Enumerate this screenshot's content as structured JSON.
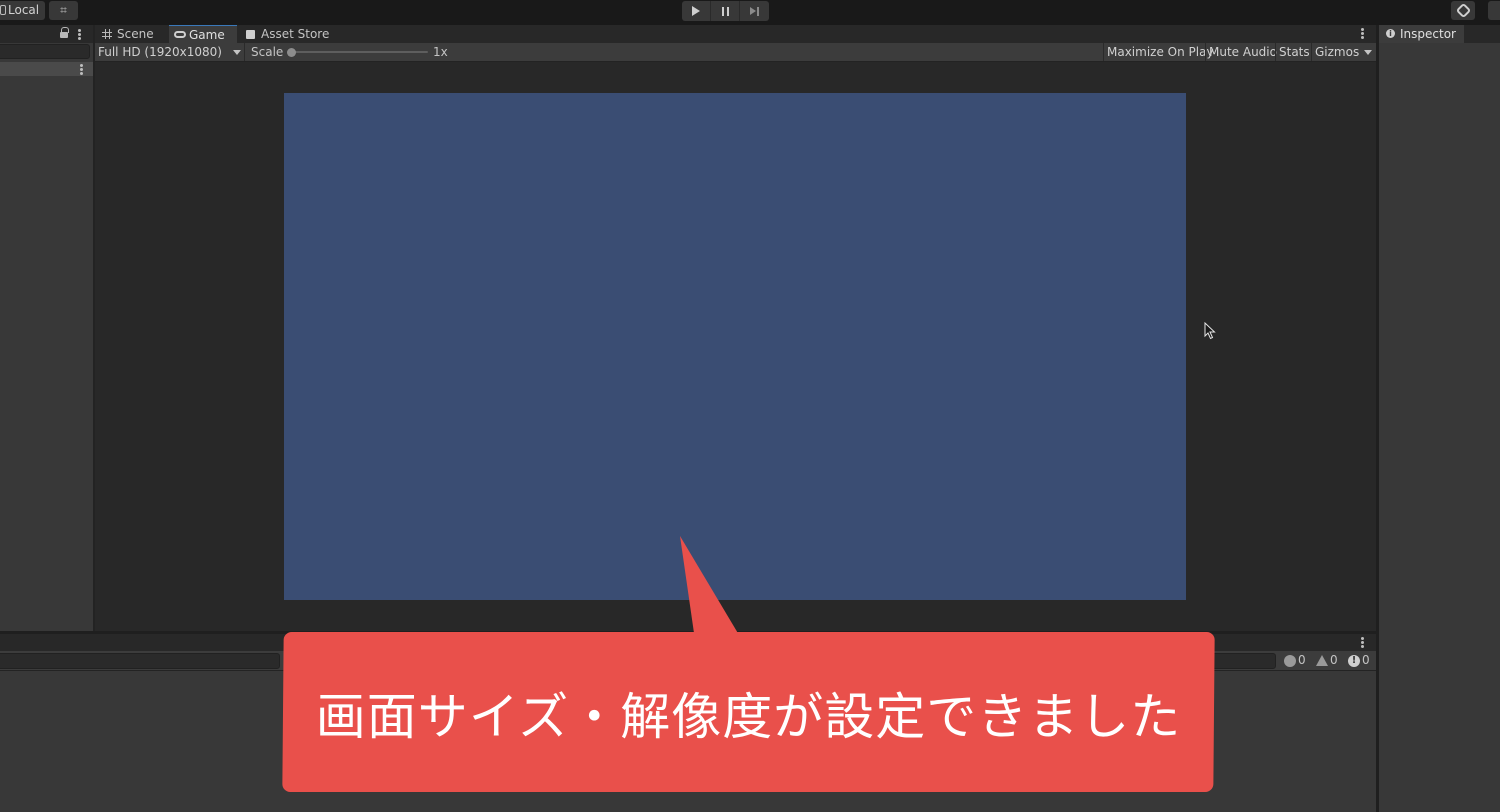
{
  "toolbar": {
    "local_label": "Local",
    "play_icon": "play-icon",
    "pause_icon": "pause-icon",
    "step_icon": "step-icon",
    "cloud_icon": "cloud-hex-icon"
  },
  "game_view": {
    "tabs": [
      {
        "label": "Scene",
        "icon": "hash-icon",
        "active": false
      },
      {
        "label": "Game",
        "icon": "gamepad-icon",
        "active": true
      },
      {
        "label": "Asset Store",
        "icon": "bag-icon",
        "active": false
      }
    ],
    "resolution": "Full HD (1920x1080)",
    "scale_label": "Scale",
    "scale_value": "1x",
    "scale_fraction": 0.0,
    "maximize_on_play": "Maximize On Play",
    "mute_audio": "Mute Audio",
    "stats": "Stats",
    "gizmos": "Gizmos",
    "render_color": "#3a4d73"
  },
  "inspector": {
    "tab_label": "Inspector",
    "icon": "info-icon"
  },
  "console": {
    "log_count": "0",
    "warning_count": "0",
    "error_count": "0"
  },
  "callout": {
    "text": "画面サイズ・解像度が設定できました",
    "color": "#e9504b"
  }
}
